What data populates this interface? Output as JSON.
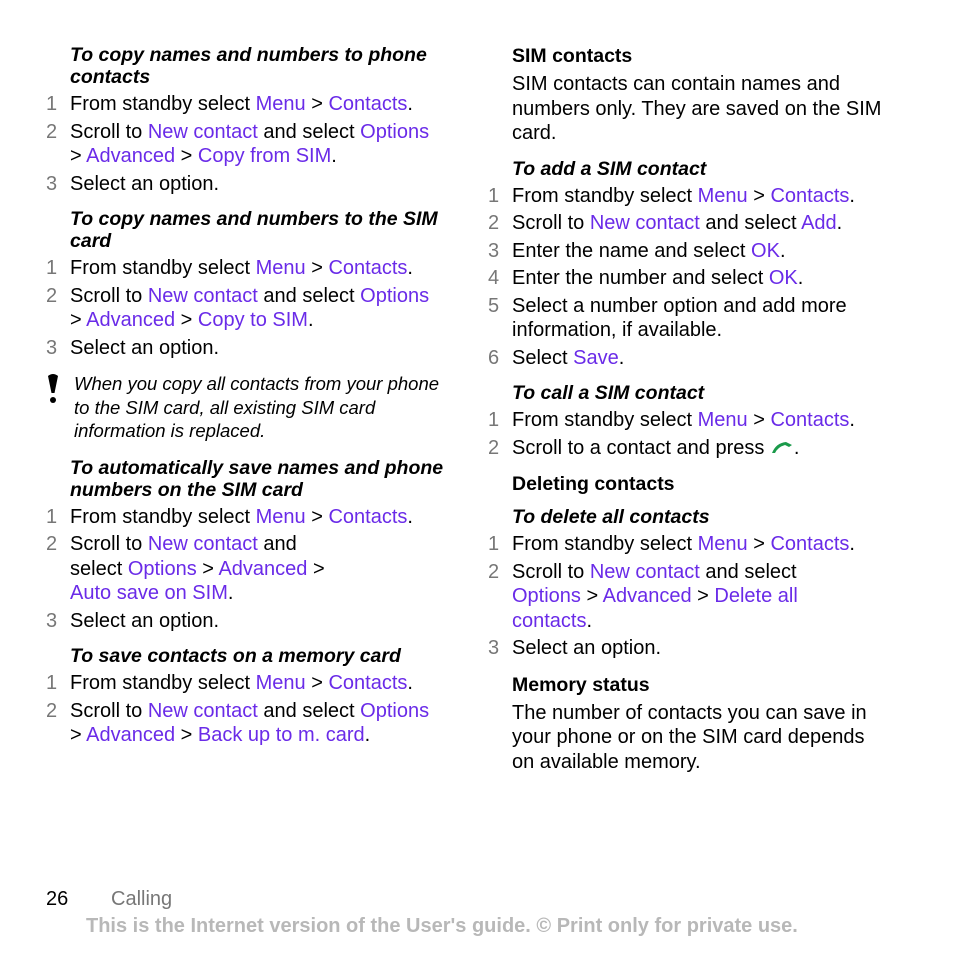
{
  "left": {
    "sec1": {
      "title": "To copy names and numbers to phone contacts",
      "s1": {
        "num": "1",
        "a": "From standby select ",
        "l1": "Menu",
        "b": " > ",
        "l2": "Contacts",
        "c": "."
      },
      "s2": {
        "num": "2",
        "a": "Scroll to ",
        "l1": "New contact",
        "b": " and select ",
        "l2": "Options",
        "c": " > ",
        "l3": "Advanced",
        "d": " > ",
        "l4": "Copy from SIM",
        "e": "."
      },
      "s3": {
        "num": "3",
        "a": "Select an option."
      }
    },
    "sec2": {
      "title": "To copy names and numbers to the SIM card",
      "s1": {
        "num": "1",
        "a": "From standby select ",
        "l1": "Menu",
        "b": " > ",
        "l2": "Contacts",
        "c": "."
      },
      "s2": {
        "num": "2",
        "a": "Scroll to ",
        "l1": "New contact",
        "b": " and select ",
        "l2": "Options",
        "c": " > ",
        "l3": "Advanced",
        "d": " > ",
        "l4": "Copy to SIM",
        "e": "."
      },
      "s3": {
        "num": "3",
        "a": "Select an option."
      }
    },
    "note": "When you copy all contacts from your phone to the SIM card, all existing SIM card information is replaced.",
    "sec3": {
      "title": "To automatically save names and phone numbers on the SIM card",
      "s1": {
        "num": "1",
        "a": "From standby select ",
        "l1": "Menu",
        "b": " > ",
        "l2": "Contacts",
        "c": "."
      },
      "s2": {
        "num": "2",
        "a": "Scroll to ",
        "l1": "New contact",
        "b": " and select ",
        "l2": "Options",
        "c": " > ",
        "l3": "Advanced",
        "d": " > ",
        "l4": "Auto save on SIM",
        "e": "."
      },
      "s3": {
        "num": "3",
        "a": "Select an option."
      }
    },
    "sec4": {
      "title": "To save contacts on a memory card",
      "s1": {
        "num": "1",
        "a": "From standby select ",
        "l1": "Menu",
        "b": " > ",
        "l2": "Contacts",
        "c": "."
      },
      "s2": {
        "num": "2",
        "a": "Scroll to ",
        "l1": "New contact",
        "b": " and select ",
        "l2": "Options",
        "c": " > ",
        "l3": "Advanced",
        "d": " > ",
        "l4": "Back up to m. card",
        "e": "."
      }
    }
  },
  "right": {
    "sim": {
      "title": "SIM contacts",
      "body": "SIM contacts can contain names and numbers only. They are saved on the SIM card."
    },
    "add": {
      "title": "To add a SIM contact",
      "s1": {
        "num": "1",
        "a": "From standby select ",
        "l1": "Menu",
        "b": " > ",
        "l2": "Contacts",
        "c": "."
      },
      "s2": {
        "num": "2",
        "a": "Scroll to ",
        "l1": "New contact",
        "b": " and select ",
        "l2": "Add",
        "c": "."
      },
      "s3": {
        "num": "3",
        "a": "Enter the name and select ",
        "l1": "OK",
        "b": "."
      },
      "s4": {
        "num": "4",
        "a": "Enter the number and select ",
        "l1": "OK",
        "b": "."
      },
      "s5": {
        "num": "5",
        "a": "Select a number option and add more information, if available."
      },
      "s6": {
        "num": "6",
        "a": "Select ",
        "l1": "Save",
        "b": "."
      }
    },
    "call": {
      "title": "To call a SIM contact",
      "s1": {
        "num": "1",
        "a": "From standby select ",
        "l1": "Menu",
        "b": " > ",
        "l2": "Contacts",
        "c": "."
      },
      "s2": {
        "num": "2",
        "a": "Scroll to a contact and press ",
        "b": "."
      }
    },
    "del_heading": "Deleting contacts",
    "del": {
      "title": "To delete all contacts",
      "s1": {
        "num": "1",
        "a": "From standby select ",
        "l1": "Menu",
        "b": " > ",
        "l2": "Contacts",
        "c": "."
      },
      "s2": {
        "num": "2",
        "a": "Scroll to ",
        "l1": "New contact",
        "b": " and select ",
        "l2": "Options",
        "c": " > ",
        "l3": "Advanced",
        "d": " > ",
        "l4": "Delete all contacts",
        "e": "."
      },
      "s3": {
        "num": "3",
        "a": "Select an option."
      }
    },
    "mem": {
      "title": "Memory status",
      "body": "The number of contacts you can save in your phone or on the SIM card depends on available memory."
    }
  },
  "footer": {
    "page": "26",
    "section": "Calling",
    "notice": "This is the Internet version of the User's guide. © Print only for private use."
  },
  "colors": {
    "link": "#6a2be8",
    "step_number": "#777777",
    "notice": "#b8b8b8",
    "call_icon": "#1a9a4a"
  }
}
